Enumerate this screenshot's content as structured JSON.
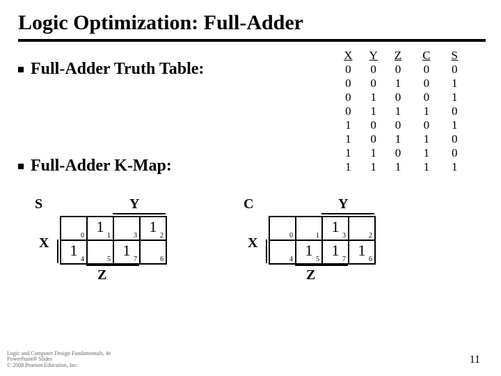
{
  "title": "Logic Optimization: Full-Adder",
  "bullets": {
    "b1": "Full-Adder Truth Table:",
    "b2": "Full-Adder K-Map:"
  },
  "truth_table": {
    "headers": [
      "X",
      "Y",
      "Z",
      "C",
      "S"
    ],
    "rows": [
      [
        "0",
        "0",
        "0",
        "0",
        "0"
      ],
      [
        "0",
        "0",
        "1",
        "0",
        "1"
      ],
      [
        "0",
        "1",
        "0",
        "0",
        "1"
      ],
      [
        "0",
        "1",
        "1",
        "1",
        "0"
      ],
      [
        "1",
        "0",
        "0",
        "0",
        "1"
      ],
      [
        "1",
        "0",
        "1",
        "1",
        "0"
      ],
      [
        "1",
        "1",
        "0",
        "1",
        "0"
      ],
      [
        "1",
        "1",
        "1",
        "1",
        "1"
      ]
    ]
  },
  "kmap_labels": {
    "s": "S",
    "c": "C",
    "x": "X",
    "y": "Y",
    "z": "Z"
  },
  "kmap_s": {
    "cells": [
      {
        "idx": "0",
        "v": ""
      },
      {
        "idx": "1",
        "v": "1"
      },
      {
        "idx": "3",
        "v": ""
      },
      {
        "idx": "2",
        "v": "1"
      },
      {
        "idx": "4",
        "v": "1"
      },
      {
        "idx": "5",
        "v": ""
      },
      {
        "idx": "7",
        "v": "1"
      },
      {
        "idx": "6",
        "v": ""
      }
    ]
  },
  "kmap_c": {
    "cells": [
      {
        "idx": "0",
        "v": ""
      },
      {
        "idx": "1",
        "v": ""
      },
      {
        "idx": "3",
        "v": "1"
      },
      {
        "idx": "2",
        "v": ""
      },
      {
        "idx": "4",
        "v": ""
      },
      {
        "idx": "5",
        "v": "1"
      },
      {
        "idx": "7",
        "v": "1"
      },
      {
        "idx": "6",
        "v": "1"
      }
    ]
  },
  "footer": {
    "l1": "Logic and Computer Design Fundamentals, 4e",
    "l2": "PowerPoint® Slides",
    "l3": "© 2008 Pearson Education, Inc."
  },
  "pagenum": "11",
  "chart_data": {
    "type": "table",
    "title": "Full-Adder Truth Table and K-Maps",
    "truth_table": {
      "inputs": [
        "X",
        "Y",
        "Z"
      ],
      "outputs": [
        "C",
        "S"
      ],
      "rows": [
        {
          "X": 0,
          "Y": 0,
          "Z": 0,
          "C": 0,
          "S": 0
        },
        {
          "X": 0,
          "Y": 0,
          "Z": 1,
          "C": 0,
          "S": 1
        },
        {
          "X": 0,
          "Y": 1,
          "Z": 0,
          "C": 0,
          "S": 1
        },
        {
          "X": 0,
          "Y": 1,
          "Z": 1,
          "C": 1,
          "S": 0
        },
        {
          "X": 1,
          "Y": 0,
          "Z": 0,
          "C": 0,
          "S": 1
        },
        {
          "X": 1,
          "Y": 0,
          "Z": 1,
          "C": 1,
          "S": 0
        },
        {
          "X": 1,
          "Y": 1,
          "Z": 0,
          "C": 1,
          "S": 0
        },
        {
          "X": 1,
          "Y": 1,
          "Z": 1,
          "C": 1,
          "S": 1
        }
      ]
    },
    "kmaps": [
      {
        "output": "S",
        "row_vars": [
          "X"
        ],
        "col_vars": [
          "Y",
          "Z"
        ],
        "col_order_minterm_idx": [
          0,
          1,
          3,
          2
        ],
        "grid": [
          [
            0,
            1,
            0,
            1
          ],
          [
            1,
            0,
            1,
            0
          ]
        ]
      },
      {
        "output": "C",
        "row_vars": [
          "X"
        ],
        "col_vars": [
          "Y",
          "Z"
        ],
        "col_order_minterm_idx": [
          0,
          1,
          3,
          2
        ],
        "grid": [
          [
            0,
            0,
            1,
            0
          ],
          [
            0,
            1,
            1,
            1
          ]
        ]
      }
    ]
  }
}
